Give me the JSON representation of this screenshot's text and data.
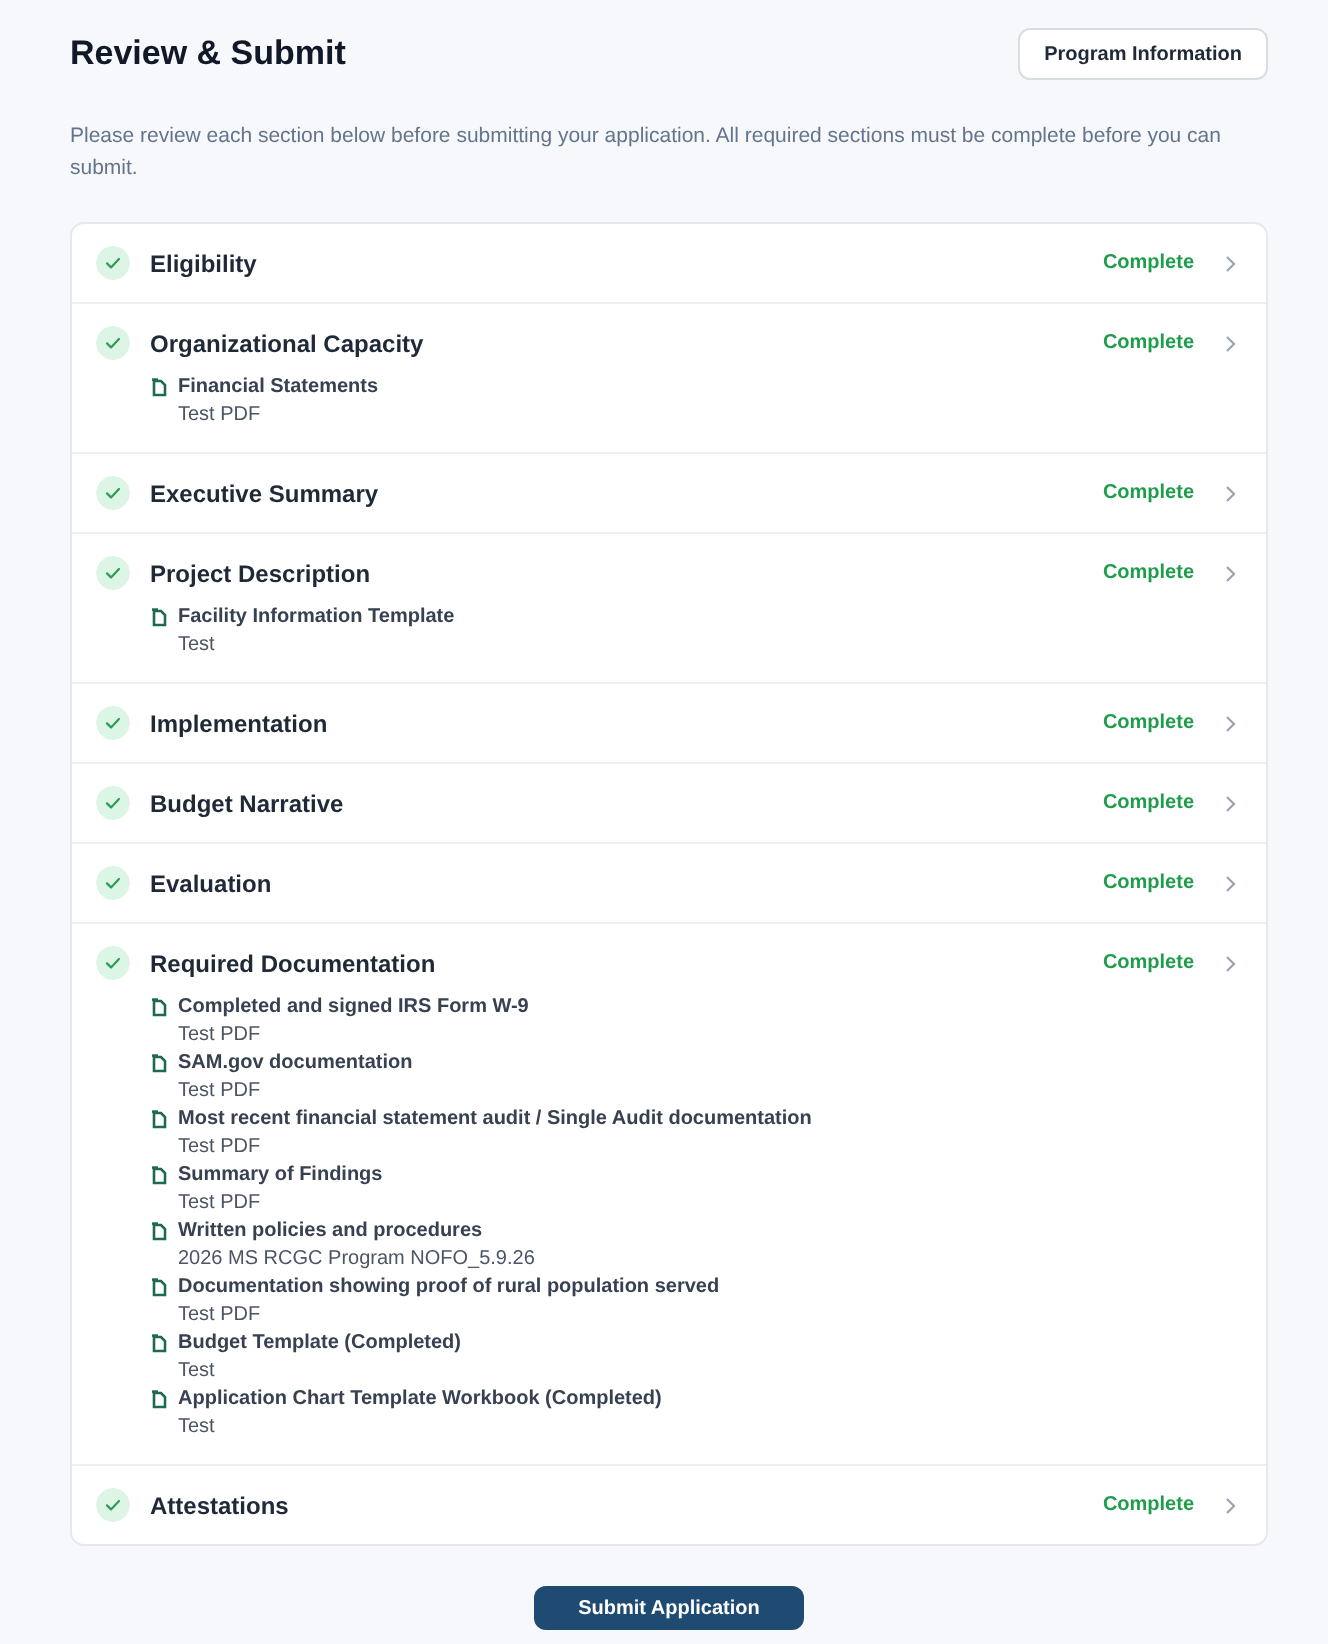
{
  "title": "Review & Submit",
  "program_button": "Program Information",
  "description": "Please review each section below before submitting your application. All required sections must be complete before you can submit.",
  "sections": [
    {
      "name": "Eligibility",
      "complete": true,
      "status": "Complete"
    },
    {
      "name": "Organizational Capacity",
      "complete": true,
      "status": "Complete",
      "documents": [
        {
          "name": "Financial Statements",
          "file": "Test PDF"
        }
      ]
    },
    {
      "name": "Executive Summary",
      "complete": true,
      "status": "Complete"
    },
    {
      "name": "Project Description",
      "complete": true,
      "status": "Complete",
      "documents": [
        {
          "name": "Facility Information Template",
          "file": "Test"
        }
      ]
    },
    {
      "name": "Implementation",
      "complete": true,
      "status": "Complete"
    },
    {
      "name": "Budget Narrative",
      "complete": true,
      "status": "Complete"
    },
    {
      "name": "Evaluation",
      "complete": true,
      "status": "Complete"
    },
    {
      "name": "Required Documentation",
      "complete": true,
      "status": "Complete",
      "documents": [
        {
          "name": "Completed and signed IRS Form W-9",
          "file": "Test PDF"
        },
        {
          "name": "SAM.gov documentation",
          "file": "Test PDF"
        },
        {
          "name": "Most recent financial statement audit / Single Audit documentation",
          "file": "Test PDF"
        },
        {
          "name": "Summary of Findings",
          "file": "Test PDF"
        },
        {
          "name": "Written policies and procedures",
          "file": "2026 MS RCGC Program NOFO_5.9.26"
        },
        {
          "name": "Documentation showing proof of rural population served",
          "file": "Test PDF"
        },
        {
          "name": "Budget Template (Completed)",
          "file": "Test"
        },
        {
          "name": "Application Chart Template Workbook (Completed)",
          "file": "Test"
        }
      ]
    },
    {
      "name": "Attestations",
      "complete": true,
      "status": "Complete"
    }
  ],
  "submit_button": "Submit Application"
}
